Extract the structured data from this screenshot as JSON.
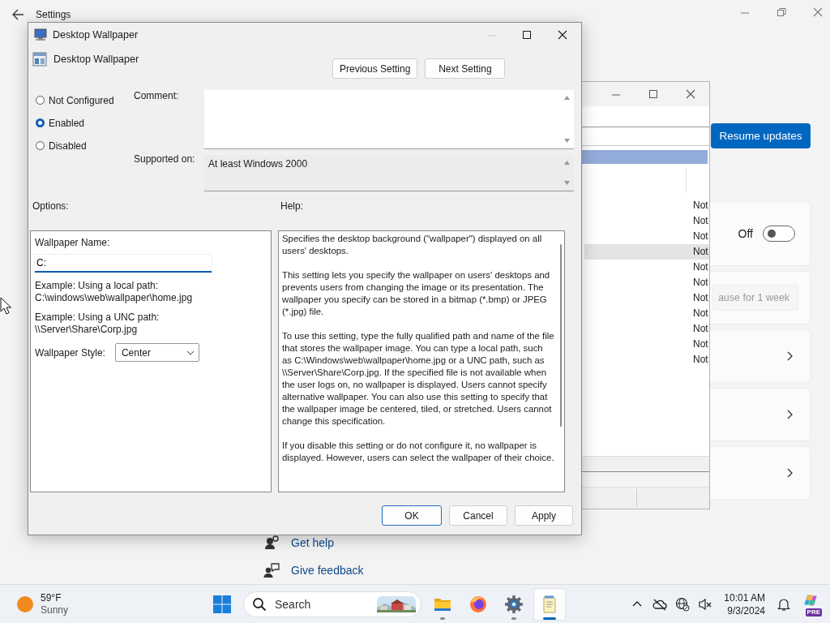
{
  "settings_window": {
    "title": "Settings",
    "resume_button": "Resume updates",
    "toggle_card": {
      "label": "Off",
      "on": false
    },
    "pause_button": "ause for 1 week",
    "links": [
      {
        "kind": "help",
        "label": "Get help"
      },
      {
        "kind": "feedback",
        "label": "Give feedback"
      }
    ]
  },
  "policy_window": {
    "rows": [
      {
        "column_3": "Not",
        "selected": false
      },
      {
        "column_3": "Not",
        "selected": false
      },
      {
        "column_3": "Not",
        "selected": false
      },
      {
        "column_3": "Not",
        "selected": true
      },
      {
        "column_3": "Not",
        "selected": false
      },
      {
        "column_3": "Not",
        "selected": false
      },
      {
        "column_3": "Not",
        "selected": false
      },
      {
        "column_3": "Not",
        "selected": false
      },
      {
        "column_3": "Not",
        "selected": false
      },
      {
        "column_3": "Not",
        "selected": false
      },
      {
        "column_3": "Not",
        "selected": false
      }
    ]
  },
  "dialog": {
    "title": "Desktop Wallpaper",
    "setting_name": "Desktop Wallpaper",
    "nav_buttons": [
      "Previous Setting",
      "Next Setting"
    ],
    "states": [
      {
        "label": "Not Configured",
        "selected": false
      },
      {
        "label": "Enabled",
        "selected": true
      },
      {
        "label": "Disabled",
        "selected": false
      }
    ],
    "comment_label": "Comment:",
    "supported_label": "Supported on:",
    "supported_value": "At least Windows 2000",
    "options_label": "Options:",
    "help_label": "Help:",
    "options": {
      "name_label": "Wallpaper Name:",
      "name_value": "C:",
      "examples": [
        {
          "caption": "Example: Using a local path:",
          "path": "C:\\windows\\web\\wallpaper\\home.jpg"
        },
        {
          "caption": "Example: Using a UNC path:",
          "path": "\\\\Server\\Share\\Corp.jpg"
        }
      ],
      "style_label": "Wallpaper Style:",
      "style_value": "Center"
    },
    "help_paragraphs": [
      "Specifies the desktop background (\"wallpaper\") displayed on all users' desktops.",
      "This setting lets you specify the wallpaper on users' desktops and prevents users from changing the image or its presentation. The wallpaper you specify can be stored in a bitmap (*.bmp) or JPEG (*.jpg) file.",
      "To use this setting, type the fully qualified path and name of the file that stores the wallpaper image. You can type a local path, such as C:\\Windows\\web\\wallpaper\\home.jpg or a UNC path, such as \\\\Server\\Share\\Corp.jpg. If the specified file is not available when the user logs on, no wallpaper is displayed. Users cannot specify alternative wallpaper. You can also use this setting to specify that the wallpaper image be centered, tiled, or stretched. Users cannot change this specification.",
      "If you disable this setting or do not configure it, no wallpaper is displayed. However, users can select the wallpaper of their choice."
    ],
    "buttons": [
      {
        "label": "OK",
        "selected": true
      },
      {
        "label": "Cancel",
        "selected": false
      },
      {
        "label": "Apply",
        "selected": false
      }
    ]
  },
  "taskbar": {
    "weather": {
      "temperature": "59°F",
      "condition": "Sunny"
    },
    "search": {
      "placeholder": "Search"
    },
    "apps": [
      {
        "kind": "folder",
        "running": true,
        "selected": false
      },
      {
        "kind": "browser",
        "running": false,
        "selected": false
      },
      {
        "kind": "settings",
        "running": true,
        "selected": false
      },
      {
        "kind": "notepad",
        "running": true,
        "selected": true
      }
    ],
    "clock": {
      "time": "10:01 AM",
      "date": "9/3/2024"
    },
    "copilot_badge": "PRE"
  }
}
